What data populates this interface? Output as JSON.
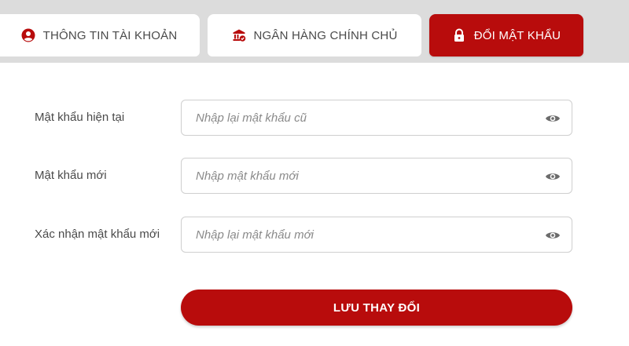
{
  "tabs": [
    {
      "label": "THÔNG TIN TÀI KHOẢN",
      "icon": "user-circle-icon",
      "active": false
    },
    {
      "label": "NGÂN HÀNG CHÍNH CHỦ",
      "icon": "bank-icon",
      "active": false
    },
    {
      "label": "ĐỔI MẬT KHẨU",
      "icon": "lock-icon",
      "active": true
    }
  ],
  "form": {
    "current_password": {
      "label": "Mật khẩu hiện tại",
      "placeholder": "Nhập lại mật khẩu cũ",
      "value": ""
    },
    "new_password": {
      "label": "Mật khẩu mới",
      "placeholder": "Nhập mật khẩu mới",
      "value": ""
    },
    "confirm_password": {
      "label": "Xác nhận mật khẩu mới",
      "placeholder": "Nhập lại mật khẩu mới",
      "value": ""
    },
    "submit_label": "LƯU THAY ĐỔI"
  },
  "colors": {
    "accent": "#b80c0c",
    "tab_bar_bg": "#dcdcdc",
    "text": "#4a4a4a",
    "input_border": "#cfcfcf",
    "icon_gray": "#6b6b6b"
  }
}
